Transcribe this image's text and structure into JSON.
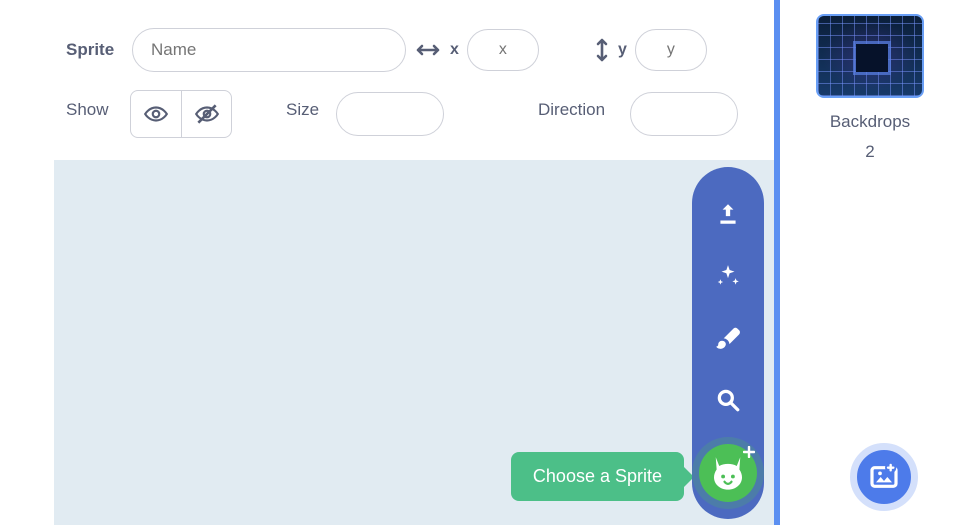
{
  "info": {
    "spriteLabel": "Sprite",
    "namePlaceholder": "Name",
    "xLabel": "x",
    "xPlaceholder": "x",
    "yLabel": "y",
    "yPlaceholder": "y",
    "showLabel": "Show",
    "sizeLabel": "Size",
    "directionLabel": "Direction"
  },
  "tooltip": {
    "chooseSprite": "Choose a Sprite"
  },
  "backdrop": {
    "label": "Backdrops",
    "count": "2"
  }
}
